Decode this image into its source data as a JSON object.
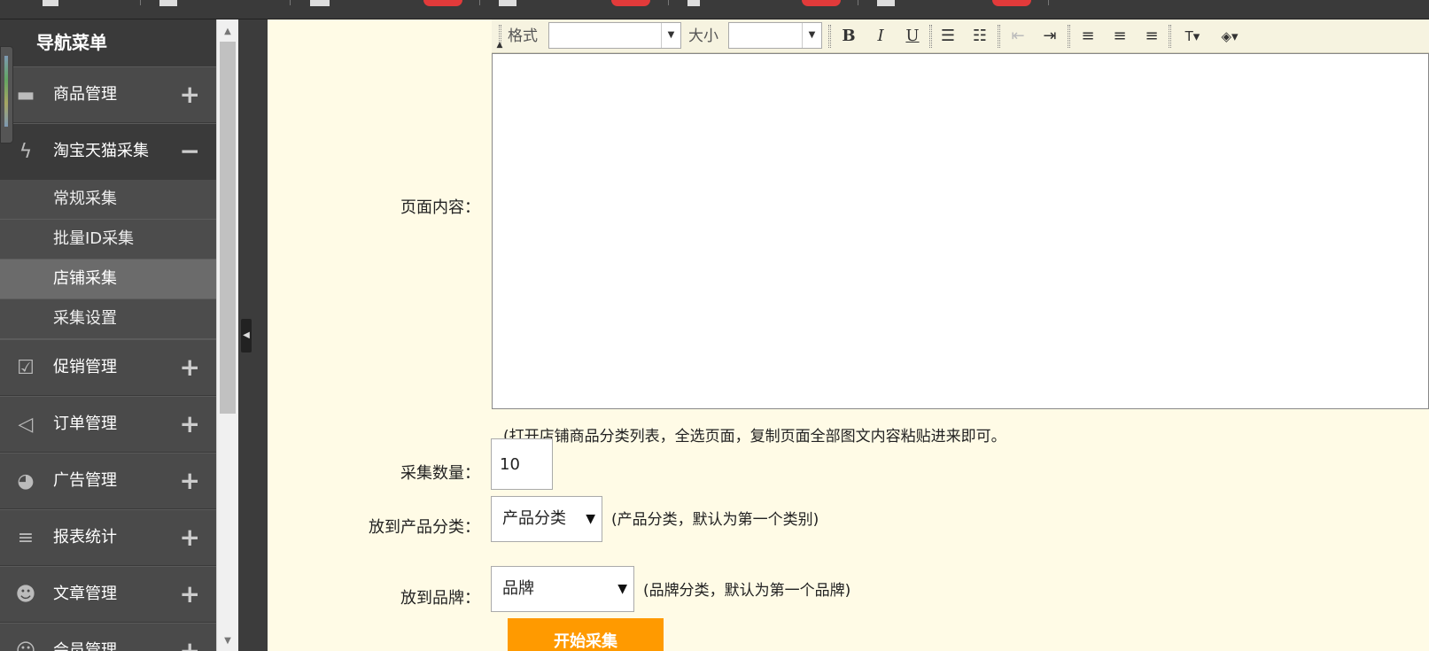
{
  "sidebar": {
    "title": "导航菜单",
    "items": [
      {
        "label": "商品管理",
        "icon": "folder-icon",
        "toggle": "+"
      },
      {
        "label": "淘宝天猫采集",
        "icon": "lightning-icon",
        "toggle": "−"
      },
      {
        "label": "促销管理",
        "icon": "clipboard-check-icon",
        "toggle": "+"
      },
      {
        "label": "订单管理",
        "icon": "megaphone-icon",
        "toggle": "+"
      },
      {
        "label": "广告管理",
        "icon": "pie-chart-icon",
        "toggle": "+"
      },
      {
        "label": "报表统计",
        "icon": "bars-icon",
        "toggle": "+"
      },
      {
        "label": "文章管理",
        "icon": "users-icon",
        "toggle": "+"
      },
      {
        "label": "会员管理",
        "icon": "user-icon",
        "toggle": "+"
      }
    ],
    "submenu": [
      {
        "label": "常规采集"
      },
      {
        "label": "批量ID采集"
      },
      {
        "label": "店铺采集"
      },
      {
        "label": "采集设置"
      }
    ]
  },
  "editor": {
    "format_label": "格式",
    "size_label": "大小",
    "format_value": "",
    "size_value": ""
  },
  "form": {
    "page_content_label": "页面内容：",
    "page_content_hint": "(打开店铺商品分类列表，全选页面，复制页面全部图文内容粘贴进来即可。",
    "count_label": "采集数量：",
    "count_value": "10",
    "category_label": "放到产品分类：",
    "category_value": "产品分类",
    "category_hint": "(产品分类，默认为第一个类别)",
    "brand_label": "放到品牌：",
    "brand_value": "品牌",
    "brand_hint": "(品牌分类，默认为第一个品牌)",
    "start_button": "开始采集"
  }
}
